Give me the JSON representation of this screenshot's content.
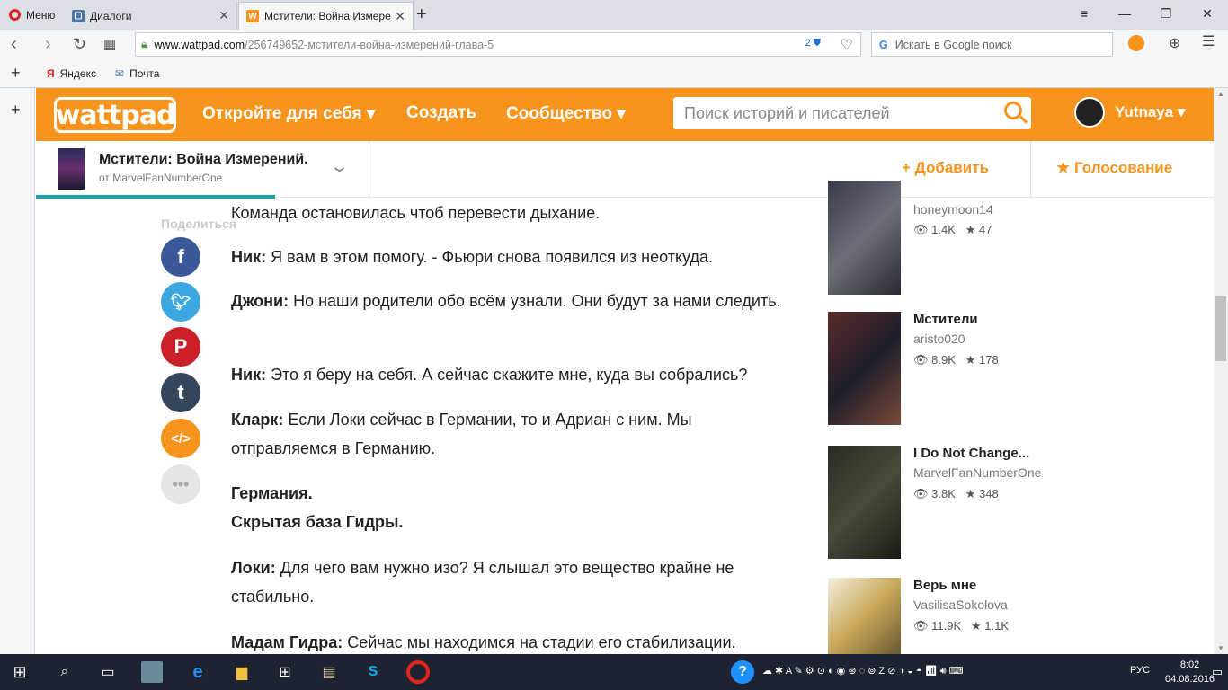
{
  "browser": {
    "menu_label": "Меню",
    "tabs": [
      {
        "label": "Диалоги"
      },
      {
        "label": "Мстители: Война Измере"
      }
    ],
    "url_host": "www.wattpad.com",
    "url_path": "/256749652-мстители-война-измерений-глава-5",
    "badge_count": "2",
    "search_placeholder": "Искать в Google поиск",
    "bookmarks": [
      {
        "label": "Яндекс"
      },
      {
        "label": "Почта"
      }
    ]
  },
  "header": {
    "logo": "wattpad",
    "nav": [
      "Откройте для себя ▾",
      "Создать",
      "Сообщество ▾"
    ],
    "search_placeholder": "Поиск историй и писателей",
    "username": "Yutnaya ▾"
  },
  "story": {
    "title": "Мстители: Война Измерений.",
    "author": "от MarvelFanNumberOne",
    "add_label": "+ Добавить",
    "vote_label": "★ Голосование"
  },
  "share": {
    "label": "Поделиться"
  },
  "content": [
    {
      "speaker": "",
      "text": "Команда остановилась чтоб перевести дыхание."
    },
    {
      "speaker": "Ник:",
      "text": " Я вам в этом помогу. - Фьюри снова появился из неоткуда."
    },
    {
      "speaker": "Джони:",
      "text": " Но наши родители обо всём узнали. Они будут за нами следить."
    },
    {
      "speaker": "Ник:",
      "text": " Это я беру на себя. А сейчас скажите мне, куда вы собрались?"
    },
    {
      "speaker": "Кларк:",
      "text": " Если Локи сейчас в Германии, то и Адриан с ним. Мы отправляемся в Германию."
    },
    {
      "speaker": "Германия.",
      "text": ""
    },
    {
      "speaker": "Скрытая база Гидры.",
      "text": ""
    },
    {
      "speaker": "Локи:",
      "text": " Для чего вам нужно изо? Я слышал это вещество крайне не стабильно."
    },
    {
      "speaker": "Мадам Гидра:",
      "text": " Сейчас мы находимся на стадии его стабилизации."
    }
  ],
  "recommendations": [
    {
      "title": "",
      "author": "honeymoon14",
      "views": "1.4K",
      "votes": "47"
    },
    {
      "title": "Мстители",
      "author": "aristo020",
      "views": "8.9K",
      "votes": "178"
    },
    {
      "title": "I Do Not Change...",
      "author": "MarvelFanNumberOne",
      "views": "3.8K",
      "votes": "348"
    },
    {
      "title": "Верь мне",
      "author": "VasilisaSokolova",
      "views": "11.9K",
      "votes": "1.1K"
    }
  ],
  "taskbar": {
    "lang": "РУС",
    "time": "8:02",
    "date": "04.08.2016"
  },
  "colors": {
    "brand": "#f7941d",
    "teal": "#12a7ab",
    "facebook": "#3b5998",
    "twitter": "#3ba7e0",
    "pinterest": "#cb2027",
    "tumblr": "#35465c",
    "embed": "#f7941d",
    "more": "#e6e6e6"
  }
}
